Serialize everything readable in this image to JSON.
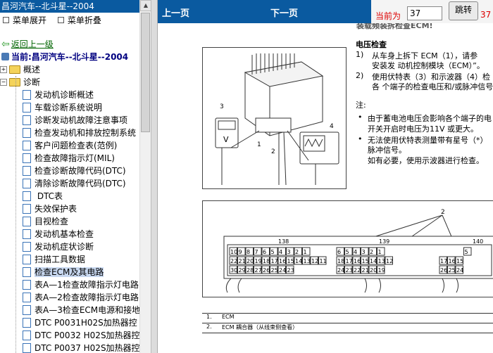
{
  "left_pane": {
    "title": "昌河汽车--北斗星--2004",
    "toolbar": {
      "expand": "菜单展开",
      "collapse": "菜单折叠"
    },
    "back_link": "返回上一级",
    "current": "当前:昌河汽车--北斗星--2004",
    "tree": [
      {
        "label": "概述",
        "expanded": false
      },
      {
        "label": "诊断",
        "expanded": true
      }
    ],
    "items": [
      "发动机诊断概述",
      "车载诊断系统说明",
      "诊断发动机故障注意事项",
      "检查发动机和排放控制系统",
      "客户问题检查表(范例)",
      "检查故障指示灯(MIL)",
      "检查诊断故障代码(DTC)",
      "清除诊断故障代码(DTC)",
      " DTC表",
      "失效保护表",
      "目视检查",
      "发动机基本检查",
      "发动机症状诊断",
      "扫描工具数据",
      "检查ECM及其电路",
      "表A—1检查故障指示灯电路",
      "表A—2检查故障指示灯电路",
      "表A—3检查ECM电源和接地",
      "DTC P0031H02S加热器控",
      "DTC P0032 H02S加热器控",
      "DTC P0037 H02S加热器控"
    ],
    "selected_index": 14
  },
  "nav": {
    "prev": "上一页",
    "next": "下一页",
    "current_label": "当前为",
    "current_value": "37",
    "jump": "跳转",
    "total": "37 /"
  },
  "document": {
    "header_cut": "装载频装拆检查ECM!",
    "section_title": "电压检查",
    "step1_num": "1)",
    "step1_line1": "从车身上拆下 ECM（1），请参",
    "step1_line2": "安装发 动机控制模块（ECM）”。",
    "step2_num": "2)",
    "step2_line1": "使用伏特表（3）和示波器（4）检",
    "step2_line2": "各 个端子的检查电压和/或脉冲信号",
    "note_label": "注:",
    "note1_line1": "由于蓄电池电压会影响各个端子的电",
    "note1_line2": "开关开启时电压为11V 或更大。",
    "note2_line1": "无法使用伏特表测量带有星号（*）",
    "note2_line2": "脉冲信号。",
    "note2_line3": "如有必要，使用示波器进行检查。",
    "fig1_labels": [
      "3",
      "1",
      "2",
      "4"
    ],
    "fig2_callout": "2",
    "connectors": [
      {
        "name": "138",
        "row1": [
          "10",
          "9",
          "8",
          "7",
          "6",
          "5",
          "4",
          "3",
          "2",
          "1"
        ],
        "row2": [
          "22",
          "21",
          "20",
          "19",
          "18",
          "17",
          "16",
          "15",
          "14",
          "13",
          "12",
          "11"
        ],
        "row3": [
          "30",
          "29",
          "28",
          "27",
          "26",
          "25",
          "24",
          "23"
        ]
      },
      {
        "name": "139",
        "row1": [
          "6",
          "5",
          "4",
          "3",
          "2",
          "1"
        ],
        "row2": [
          "18",
          "17",
          "16",
          "15",
          "14",
          "13",
          "12"
        ],
        "row3": [
          "24",
          "23",
          "22",
          "21",
          "20",
          "19"
        ]
      },
      {
        "name": "140",
        "row1": [
          "5"
        ],
        "row2": [
          "17",
          "16",
          "15"
        ],
        "row3": [
          "26",
          "25",
          "24"
        ]
      }
    ],
    "legend": [
      {
        "num": "1.",
        "text": "ECM"
      },
      {
        "num": "2.",
        "text": "ECM 耦合器（从线束侧查看）"
      }
    ]
  }
}
